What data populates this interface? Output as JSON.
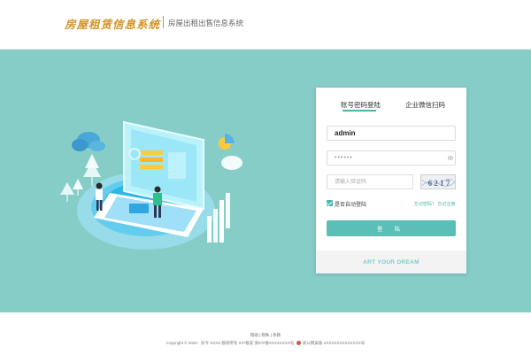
{
  "header": {
    "logo_text": "房屋租赁信息系统",
    "subtitle": "房屋出租出售信息系统"
  },
  "login": {
    "tabs": [
      "账号密码登陆",
      "企业微信扫码"
    ],
    "active_tab": 0,
    "username_value": "admin",
    "password_value": "••••••",
    "captcha_placeholder": "请输入验证码",
    "captcha_text": "6 2 1 7",
    "remember_label": "是否自动登陆",
    "remember_checked": true,
    "forgot_label": "忘记密码？ 忘记注册",
    "submit_label": "登 陆",
    "motto": "ART YOUR DREAM"
  },
  "footer": {
    "links": [
      "帮助",
      "隐私",
      "条款"
    ],
    "copyright": "Copyright © 2020 · 房今 XXXX 版权所有 ICP备案 浙ICP备XXXXXXXX号",
    "police": "浙公网安备 XXXXXXXXXXXXXX号"
  },
  "colors": {
    "background_band": "#86cdc8",
    "accent": "#47b5ad",
    "button": "#5bbfb8",
    "logo": "#d49226"
  }
}
